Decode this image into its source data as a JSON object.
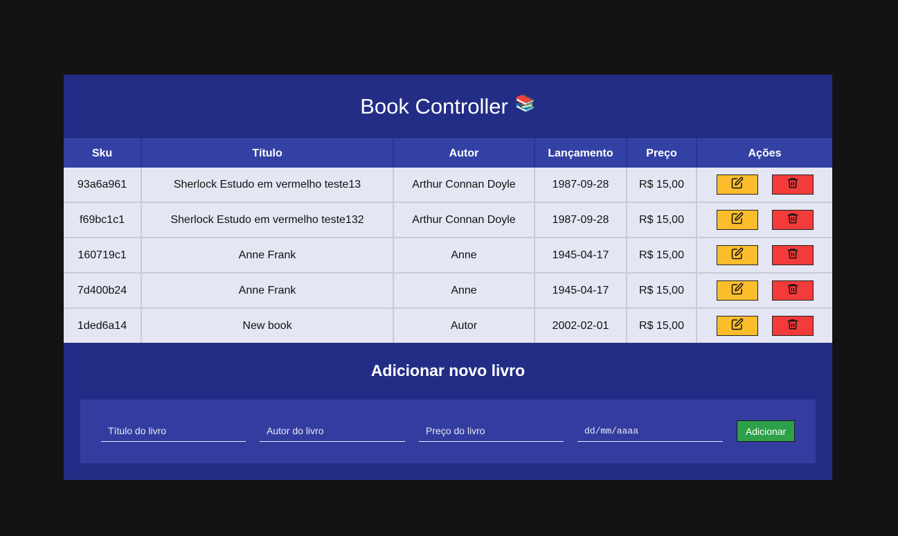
{
  "header": {
    "title": "Book Controller",
    "emoji": "📚"
  },
  "table": {
    "columns": [
      "Sku",
      "Título",
      "Autor",
      "Lançamento",
      "Preço",
      "Ações"
    ],
    "rows": [
      {
        "sku": "93a6a961",
        "titulo": "Sherlock Estudo em vermelho teste13",
        "autor": "Arthur Connan Doyle",
        "lancamento": "1987-09-28",
        "preco": "R$ 15,00"
      },
      {
        "sku": "f69bc1c1",
        "titulo": "Sherlock Estudo em vermelho teste132",
        "autor": "Arthur Connan Doyle",
        "lancamento": "1987-09-28",
        "preco": "R$ 15,00"
      },
      {
        "sku": "160719c1",
        "titulo": "Anne Frank",
        "autor": "Anne",
        "lancamento": "1945-04-17",
        "preco": "R$ 15,00"
      },
      {
        "sku": "7d400b24",
        "titulo": "Anne Frank",
        "autor": "Anne",
        "lancamento": "1945-04-17",
        "preco": "R$ 15,00"
      },
      {
        "sku": "1ded6a14",
        "titulo": "New book",
        "autor": "Autor",
        "lancamento": "2002-02-01",
        "preco": "R$ 15,00"
      }
    ],
    "edit_icon": "edit-icon",
    "delete_icon": "trash-icon"
  },
  "form": {
    "title": "Adicionar novo livro",
    "title_placeholder": "Título do livro",
    "author_placeholder": "Autor do livro",
    "price_placeholder": "Preço do livro",
    "date_placeholder": "dd/mm/aaaa",
    "submit_label": "Adicionar"
  },
  "colors": {
    "background": "#131313",
    "panel": "#232d85",
    "header_row": "#3441a4",
    "row": "#e4e6f3",
    "edit_button": "#fbbd2c",
    "delete_button": "#f33b3b",
    "add_button": "#2ea04a"
  }
}
